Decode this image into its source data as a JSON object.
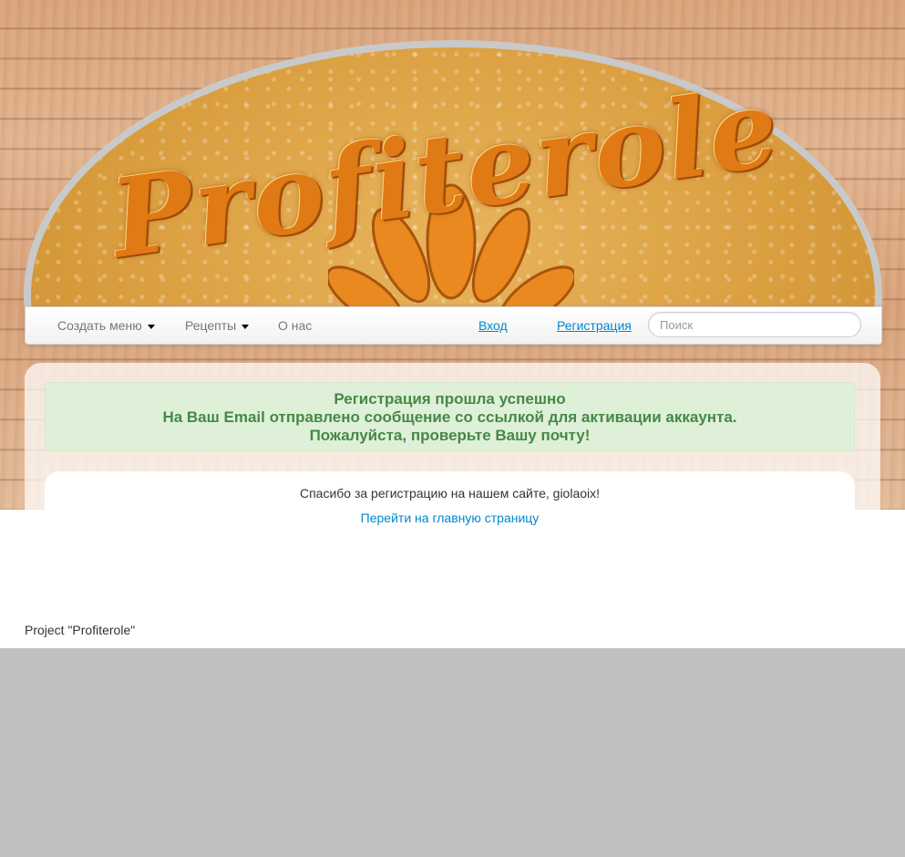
{
  "logo": {
    "text": "Profiterole"
  },
  "navbar": {
    "items": [
      {
        "label": "Создать меню",
        "dropdown": true
      },
      {
        "label": "Рецепты",
        "dropdown": true
      },
      {
        "label": "О нас",
        "dropdown": false
      }
    ],
    "login_label": "Вход",
    "register_label": "Регистрация",
    "search_placeholder": "Поиск"
  },
  "alert": {
    "line1": "Регистрация прошла успешно",
    "line2": "На Ваш Email отправлено сообщение со ссылкой для активации аккаунта.",
    "line3": "Пожалуйста, проверьте Вашу почту!"
  },
  "content": {
    "thanks_text": "Спасибо за регистрацию на нашем сайте, giolaoix!",
    "home_link": "Перейти на главную страницу"
  },
  "footer": {
    "text": "Project \"Profiterole\""
  },
  "colors": {
    "alert_text": "#468847",
    "alert_bg": "#dff0d8",
    "link": "#0088cc",
    "logo_text": "#e07a14"
  }
}
